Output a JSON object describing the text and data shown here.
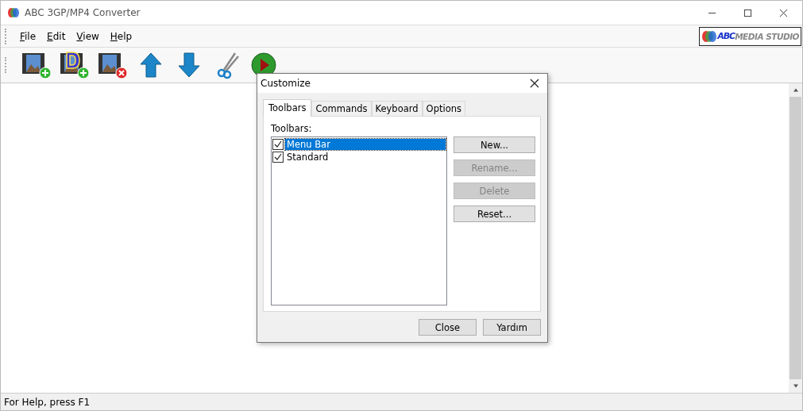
{
  "window": {
    "title": "ABC 3GP/MP4 Converter"
  },
  "menu": [
    {
      "label": "File"
    },
    {
      "label": "Edit"
    },
    {
      "label": "View"
    },
    {
      "label": "Help"
    }
  ],
  "logo": {
    "brand": "ABC",
    "text": "MEDIA STUDIO"
  },
  "toolbar": [
    {
      "kind": "film-add"
    },
    {
      "kind": "dvd-add"
    },
    {
      "kind": "film-remove"
    },
    {
      "kind": "up"
    },
    {
      "kind": "down"
    },
    {
      "kind": "cut"
    },
    {
      "kind": "play"
    }
  ],
  "dialog": {
    "title": "Customize",
    "tabs": [
      {
        "label": "Toolbars",
        "selected": true
      },
      {
        "label": "Commands",
        "selected": false
      },
      {
        "label": "Keyboard",
        "selected": false
      },
      {
        "label": "Options",
        "selected": false
      }
    ],
    "list_label": "Toolbars:",
    "items": [
      {
        "label": "Menu Bar",
        "checked": true,
        "selected": true
      },
      {
        "label": "Standard",
        "checked": true,
        "selected": false
      }
    ],
    "side_buttons": [
      {
        "label": "New...",
        "disabled": false
      },
      {
        "label": "Rename...",
        "disabled": true
      },
      {
        "label": "Delete",
        "disabled": true
      },
      {
        "label": "Reset...",
        "disabled": false
      }
    ],
    "buttons": [
      {
        "label": "Close"
      },
      {
        "label": "Yardım"
      }
    ]
  },
  "status_bar": "For Help, press F1"
}
